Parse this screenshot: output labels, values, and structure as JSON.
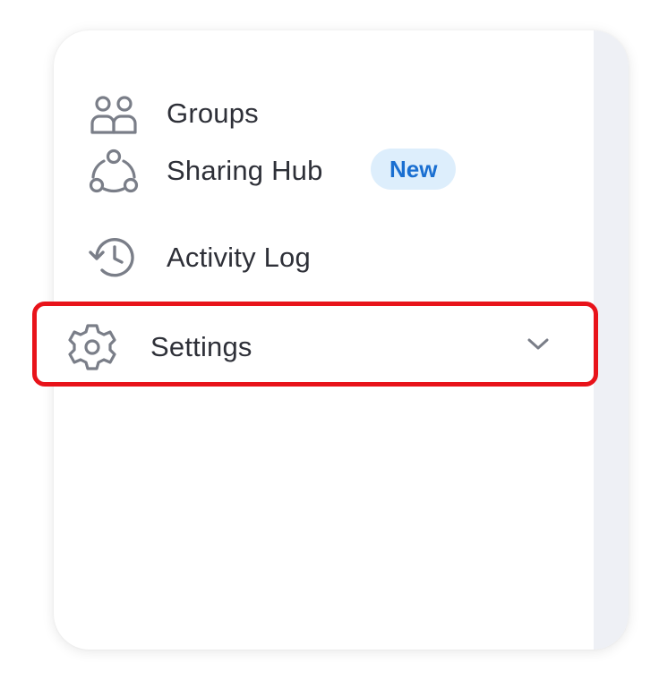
{
  "nav": {
    "items": [
      {
        "label": "Groups",
        "icon": "groups-icon"
      },
      {
        "label": "Sharing Hub",
        "icon": "sharing-hub-icon",
        "badge": "New"
      },
      {
        "label": "Activity Log",
        "icon": "activity-log-icon"
      },
      {
        "label": "Settings",
        "icon": "gear-icon",
        "expandable": true,
        "expand_icon": "chevron-down-icon"
      }
    ]
  },
  "colors": {
    "text": "#2e3038",
    "icon": "#7a7e88",
    "badge_bg": "#ddeefc",
    "badge_text": "#1a6fd1",
    "highlight_border": "#e8131a",
    "side_panel": "#eef0f5"
  }
}
